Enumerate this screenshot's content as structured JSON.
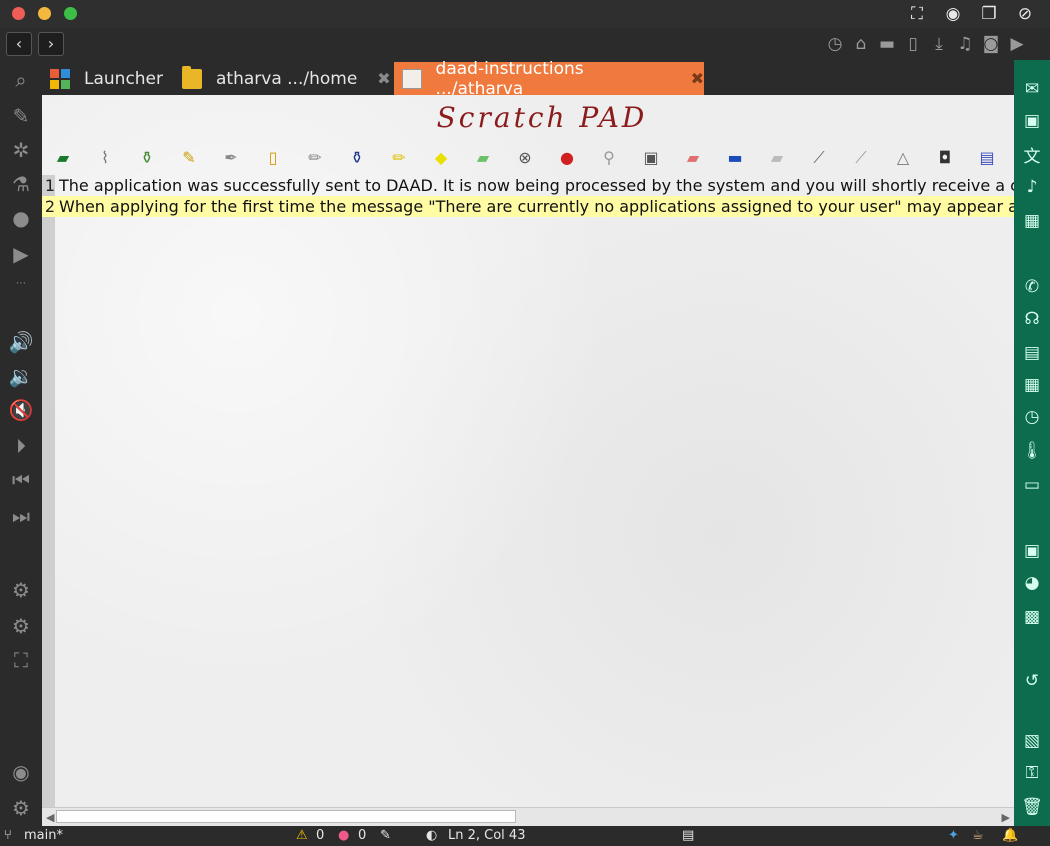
{
  "tabs": [
    {
      "label": "Launcher",
      "icon": "launcher-icon",
      "active": false
    },
    {
      "label": "atharva .../home",
      "icon": "folder-icon",
      "active": false
    },
    {
      "label": "daad-instructions .../atharva",
      "icon": "document-icon",
      "active": true
    }
  ],
  "navigation": {
    "back": "‹",
    "forward": "›"
  },
  "editor": {
    "logo_text": "Scratch PAD",
    "lines": [
      {
        "number": "1",
        "text": "The application was successfully sent to DAAD. It is now being processed by the system and you will shortly receive a c"
      },
      {
        "number": "2",
        "text": "When applying for the first time the message \"There are currently no applications assigned to your user\" may appear a"
      }
    ]
  },
  "status": {
    "branch": "main*",
    "warnings": "0",
    "errors": "0",
    "cursor": "Ln 2, Col 43"
  },
  "colors": {
    "accent_tab": "#f07a3e",
    "right_sidebar": "#0d6b4e",
    "active_line": "#fffca3",
    "logo": "#8b1c1c"
  }
}
